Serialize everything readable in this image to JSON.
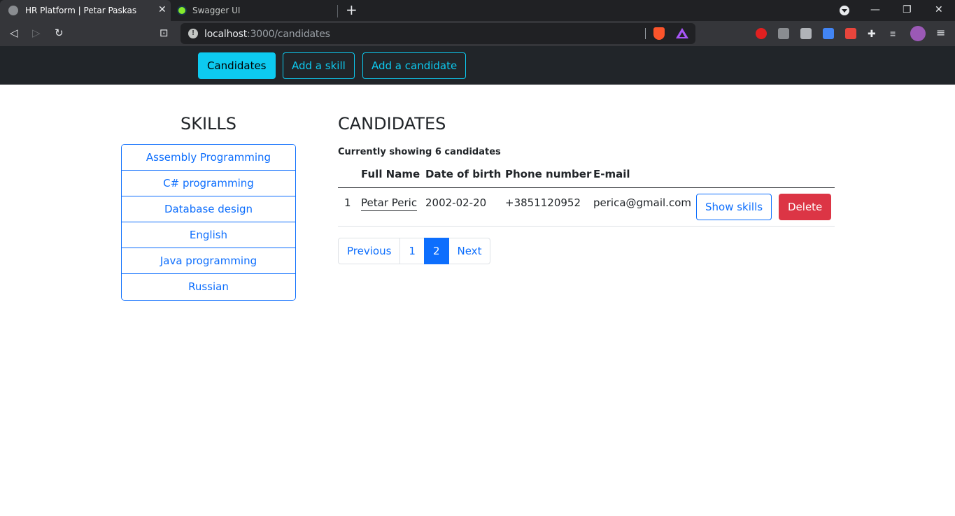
{
  "browser": {
    "tabs": [
      {
        "title": "HR Platform | Petar Paskas",
        "active": true
      },
      {
        "title": "Swagger UI",
        "active": false
      }
    ],
    "tab_close": "✕",
    "new_tab": "+",
    "url_host": "localhost",
    "url_path": ":3000/candidates",
    "window_controls": {
      "minimize": "—",
      "restore": "❐",
      "close": "✕"
    }
  },
  "navbar": {
    "buttons": [
      {
        "label": "Candidates",
        "active": true
      },
      {
        "label": "Add a skill",
        "active": false
      },
      {
        "label": "Add a candidate",
        "active": false
      }
    ]
  },
  "skills": {
    "title": "SKILLS",
    "items": [
      "Assembly Programming",
      "C# programming",
      "Database design",
      "English",
      "Java programming",
      "Russian"
    ]
  },
  "candidates": {
    "title": "CANDIDATES",
    "showing_text": "Currently showing 6 candidates",
    "columns": [
      "Full Name",
      "Date of birth",
      "Phone number",
      "E-mail"
    ],
    "rows": [
      {
        "index": "1",
        "full_name": "Petar Peric",
        "date_of_birth": "2002-02-20",
        "phone": "+3851120952",
        "email": "perica@gmail.com"
      }
    ],
    "show_skills_label": "Show skills",
    "delete_label": "Delete"
  },
  "pagination": {
    "previous": "Previous",
    "pages": [
      "1",
      "2"
    ],
    "current_page": "2",
    "next": "Next"
  },
  "colors": {
    "navbar_bg": "#212529",
    "info": "#0dcaf0",
    "primary": "#0d6efd",
    "danger": "#dc3545"
  },
  "icons": [
    "back-icon",
    "forward-icon",
    "reload-icon",
    "bookmark-icon",
    "site-info-icon",
    "brave-shields-icon",
    "brave-rewards-icon",
    "extensions-icon",
    "reading-list-icon",
    "menu-icon"
  ]
}
